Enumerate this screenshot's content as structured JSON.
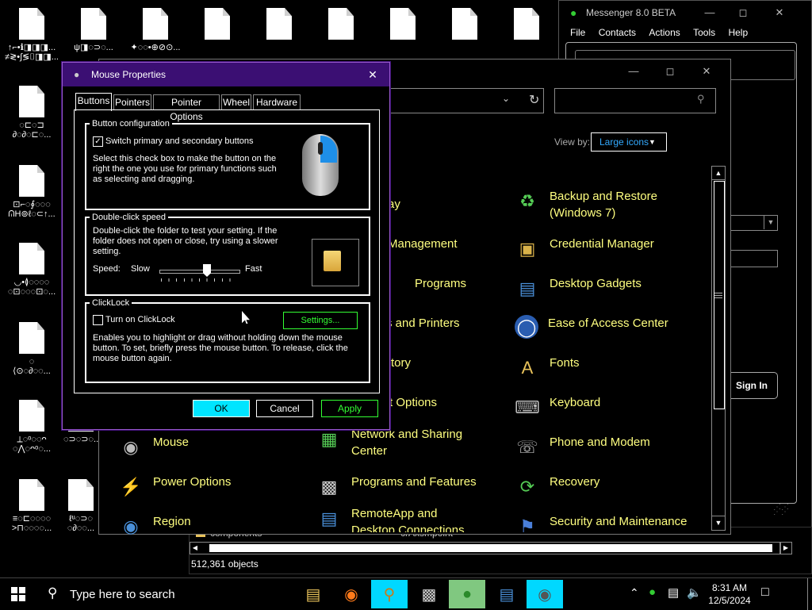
{
  "desktop": {
    "icons": [
      {
        "l1": "↑⌐•ℹ◨◨◨...",
        "l2": "≠≷•∫≶⌷◨◨..."
      },
      {
        "l1": "ψ◨◌⊃◌...",
        "l2": ""
      },
      {
        "l1": "✦◌◌•⊕⊘⊙...",
        "l2": ""
      },
      {
        "l1": "",
        "l2": ""
      },
      {
        "l1": "",
        "l2": ""
      },
      {
        "l1": "",
        "l2": ""
      },
      {
        "l1": "",
        "l2": ""
      },
      {
        "l1": "",
        "l2": ""
      },
      {
        "l1": "",
        "l2": ""
      },
      {
        "l1": "◌⊏◌⊐",
        "l2": "∂◌∂◌⊏◌..."
      },
      {
        "l1": "⊡⌐◌∮◌◌◌",
        "l2": "ᕬH⊚ℓ◌⊂↑..."
      },
      {
        "l1": "◡•≬◌◌◌◌",
        "l2": "◌⊡◌◌◌⊡◌..."
      },
      {
        "l1": "◌",
        "l2": "⟨⊙◌∂◌◌..."
      },
      {
        "l1": "⟂◌ᵒ◌◌ᴖ",
        "l2": "◌⋀◌ᴖᵒ◌..."
      },
      {
        "l1": "",
        "l2": "◌⊃◌⊃◌..."
      },
      {
        "l1": "≡◌⊏◌◌◌◌",
        "l2": ">⊓◌◌◌◌..."
      },
      {
        "l1": "ℓᵘ◌⊃◌",
        "l2": "◌∂◌◌..."
      }
    ]
  },
  "messenger": {
    "title": "Messenger 8.0 BETA",
    "menu": [
      "File",
      "Contacts",
      "Actions",
      "Tools",
      "Help"
    ],
    "sign_in": "Sign In"
  },
  "explorer": {
    "row1": "components",
    "row2": "crAxsmpoint",
    "status": "512,361 objects"
  },
  "control_panel": {
    "view_by_label": "View by:",
    "view_by_value": "Large icons",
    "left_partial": [
      "ay",
      "Management",
      "Programs",
      "s and Printers",
      "tory",
      "t Options"
    ],
    "items": [
      {
        "label": "Backup and Restore (Windows 7)",
        "icon": "backup-restore-icon"
      },
      {
        "label": "Credential Manager",
        "icon": "credential-manager-icon"
      },
      {
        "label": "Desktop Gadgets",
        "icon": "desktop-gadgets-icon"
      },
      {
        "label": "Ease of Access Center",
        "icon": "ease-of-access-icon"
      },
      {
        "label": "Fonts",
        "icon": "fonts-icon"
      },
      {
        "label": "Keyboard",
        "icon": "keyboard-icon"
      },
      {
        "label": "Mouse",
        "icon": "mouse-icon"
      },
      {
        "label": "Network and Sharing Center",
        "icon": "network-icon"
      },
      {
        "label": "Phone and Modem",
        "icon": "phone-modem-icon"
      },
      {
        "label": "Power Options",
        "icon": "power-options-icon"
      },
      {
        "label": "Programs and Features",
        "icon": "programs-features-icon"
      },
      {
        "label": "Recovery",
        "icon": "recovery-icon"
      },
      {
        "label": "Region",
        "icon": "region-icon"
      },
      {
        "label": "RemoteApp and Desktop Connections",
        "icon": "remoteapp-icon"
      },
      {
        "label": "Security and Maintenance",
        "icon": "security-maintenance-icon"
      }
    ]
  },
  "dialog": {
    "title": "Mouse Properties",
    "tabs": [
      "Buttons",
      "Pointers",
      "Pointer Options",
      "Wheel",
      "Hardware"
    ],
    "button_config": {
      "label": "Button configuration",
      "checkbox_label": "Switch primary and secondary buttons",
      "checked": "✓",
      "desc": "Select this check box to make the button on the right the one you use for primary functions such as selecting and dragging."
    },
    "double_click": {
      "label": "Double-click speed",
      "desc": "Double-click the folder to test your setting. If the folder does not open or close, try using a slower setting.",
      "speed_label": "Speed:",
      "slow": "Slow",
      "fast": "Fast",
      "slider_value": 0.6
    },
    "clicklock": {
      "label": "ClickLock",
      "checkbox_label": "Turn on ClickLock",
      "settings_button": "Settings...",
      "desc": "Enables you to highlight or drag without holding down the mouse button. To set, briefly press the mouse button. To release, click the mouse button again."
    },
    "ok": "OK",
    "cancel": "Cancel",
    "apply": "Apply"
  },
  "taskbar": {
    "search_placeholder": "Type here to search",
    "time": "8:31 AM",
    "date": "12/5/2024"
  },
  "colors": {
    "dialog_title": "#3b0f73",
    "link_yellow": "#ffff80",
    "ok_button": "#00e5ff",
    "button_green": "#33ff33"
  }
}
